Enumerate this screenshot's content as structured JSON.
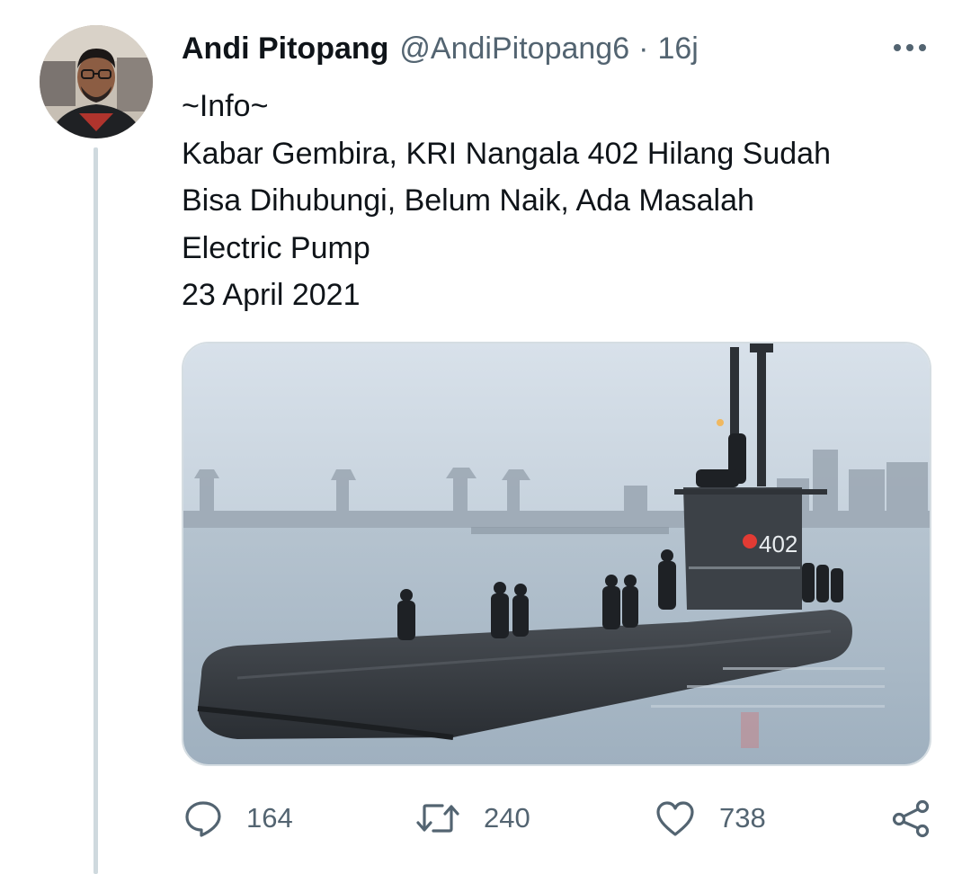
{
  "author": {
    "name": "Andi Pitopang",
    "handle": "@AndiPitopang6",
    "separator": "·",
    "time": "16j"
  },
  "tweet": {
    "lines": [
      "~Info~",
      "Kabar Gembira, KRI Nangala 402 Hilang Sudah",
      "Bisa Dihubungi, Belum Naik, Ada Masalah",
      "Electric Pump",
      "23 April 2021"
    ],
    "hull_number": "402"
  },
  "actions": {
    "replies": "164",
    "retweets": "240",
    "likes": "738"
  },
  "icons": {
    "more": "more-horizontal-icon",
    "reply": "reply-bubble-icon",
    "retweet": "retweet-icon",
    "like": "heart-icon",
    "share": "share-icon"
  },
  "colors": {
    "text": "#0f1419",
    "secondary": "#536471",
    "thread_line": "#cfd9de",
    "media_border": "#d5dde2"
  }
}
